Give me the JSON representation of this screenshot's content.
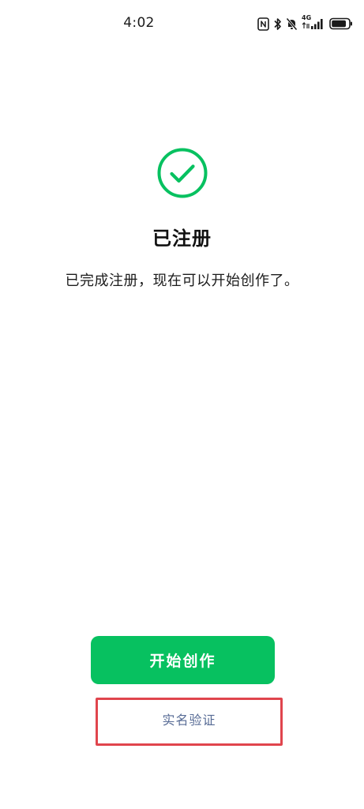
{
  "status_bar": {
    "time": "4:02",
    "network_type": "4G",
    "icons": [
      "nfc-icon",
      "bluetooth-icon",
      "mute-icon",
      "signal-icon",
      "battery-icon"
    ],
    "battery_level": 0.85
  },
  "main": {
    "success_icon": "check-circle-icon",
    "title": "已注册",
    "description": "已完成注册，现在可以开始创作了。"
  },
  "actions": {
    "primary_label": "开始创作",
    "secondary_label": "实名验证"
  },
  "colors": {
    "accent": "#07c160",
    "link": "#576b95",
    "highlight": "#e0454d"
  }
}
